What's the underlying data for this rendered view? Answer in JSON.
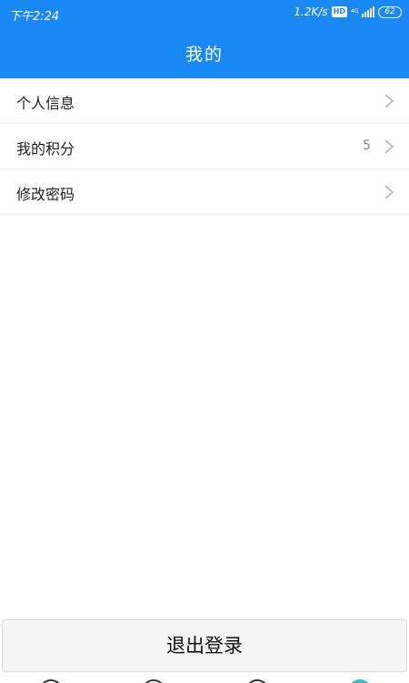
{
  "status_bar": {
    "time": "下午2:24",
    "net_speed": "1.2K/s",
    "hd": "HD",
    "net_type": "4G",
    "battery": "62"
  },
  "header": {
    "title": "我的"
  },
  "menu": {
    "items": [
      {
        "label": "个人信息",
        "value": "",
        "icon": "chevron-right-icon"
      },
      {
        "label": "我的积分",
        "value": "5",
        "icon": "chevron-right-icon"
      },
      {
        "label": "修改密码",
        "value": "",
        "icon": "chevron-right-icon"
      }
    ]
  },
  "logout": {
    "label": "退出登录"
  },
  "tabbar": {
    "icons": [
      "tab-home-icon",
      "tab-favorite-icon",
      "tab-message-icon",
      "tab-profile-icon"
    ],
    "active_index": 3,
    "active_color": "#3ab6c6"
  },
  "colors": {
    "brand": "#1a88f5",
    "divider": "#ececec",
    "chevron": "#b5b5b5"
  }
}
